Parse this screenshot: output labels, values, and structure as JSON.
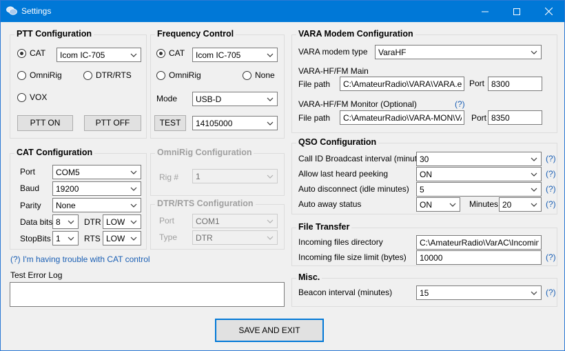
{
  "window": {
    "title": "Settings",
    "minimize": "—",
    "maximize": "☐",
    "close": "✕"
  },
  "ptt": {
    "title": "PTT Configuration",
    "cat_label": "CAT",
    "cat_radio": "Icom IC-705",
    "omnirig_label": "OmniRig",
    "dtr_rts_label": "DTR/RTS",
    "vox_label": "VOX",
    "ptt_on": "PTT ON",
    "ptt_off": "PTT OFF"
  },
  "freq": {
    "title": "Frequency Control",
    "cat_label": "CAT",
    "cat_radio": "Icom IC-705",
    "omnirig_label": "OmniRig",
    "none_label": "None",
    "mode_label": "Mode",
    "mode_value": "USB-D",
    "test_button": "TEST",
    "frequency_value": "14105000"
  },
  "catcfg": {
    "title": "CAT Configuration",
    "port_label": "Port",
    "port_value": "COM5",
    "baud_label": "Baud",
    "baud_value": "19200",
    "parity_label": "Parity",
    "parity_value": "None",
    "databits_label": "Data bits",
    "databits_value": "8",
    "dtr_label": "DTR",
    "dtr_value": "LOW",
    "stopbits_label": "StopBits",
    "stopbits_value": "1",
    "rts_label": "RTS",
    "rts_value": "LOW",
    "trouble_link": "(?) I'm having trouble with CAT control"
  },
  "omnirigcfg": {
    "title": "OmniRig Configuration",
    "rig_label": "Rig #",
    "rig_value": "1"
  },
  "dtrrtscfg": {
    "title": "DTR/RTS Configuration",
    "port_label": "Port",
    "port_value": "COM1",
    "type_label": "Type",
    "type_value": "DTR"
  },
  "testlog": {
    "label": "Test Error Log",
    "value": ""
  },
  "vara": {
    "title": "VARA Modem Configuration",
    "type_label": "VARA modem type",
    "type_value": "VaraHF",
    "main_label": "VARA-HF/FM Main",
    "main_path_label": "File path",
    "main_path_value": "C:\\AmateurRadio\\VARA\\VARA.exe",
    "main_port_label": "Port",
    "main_port_value": "8300",
    "monitor_label": "VARA-HF/FM Monitor (Optional)",
    "monitor_help": "(?)",
    "monitor_path_label": "File path",
    "monitor_path_value": "C:\\AmateurRadio\\VARA-MON\\VARA",
    "monitor_port_label": "Port",
    "monitor_port_value": "8350"
  },
  "qso": {
    "title": "QSO Configuration",
    "callid_label": "Call ID Broadcast interval (minutes)",
    "callid_value": "30",
    "peek_label": "Allow last heard peeking",
    "peek_value": "ON",
    "autodisc_label": "Auto disconnect (idle minutes)",
    "autodisc_value": "5",
    "away_label": "Auto away status",
    "away_value": "ON",
    "minutes_label": "Minutes",
    "minutes_value": "20",
    "help": "(?)"
  },
  "filetransfer": {
    "title": "File Transfer",
    "dir_label": "Incoming files directory",
    "dir_value": "C:\\AmateurRadio\\VarAC\\Incoming",
    "limit_label": "Incoming file size limit (bytes)",
    "limit_value": "10000",
    "help": "(?)"
  },
  "misc": {
    "title": "Misc.",
    "beacon_label": "Beacon interval (minutes)",
    "beacon_value": "15",
    "help": "(?)"
  },
  "save_button": "SAVE AND EXIT"
}
